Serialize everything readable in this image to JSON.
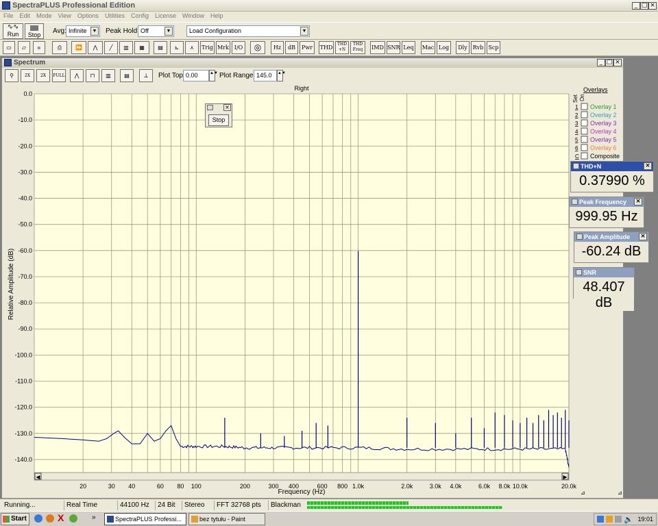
{
  "app": {
    "title": "SpectraPLUS Professional Edition",
    "menu": [
      "File",
      "Edit",
      "Mode",
      "View",
      "Options",
      "Utilities",
      "Config",
      "License",
      "Window",
      "Help"
    ]
  },
  "toolbar1": {
    "run_label": "Run",
    "stop_label": "Stop",
    "avg_label": "Avg:",
    "avg_value": "Infinite",
    "peak_hold_label": "Peak Hold:",
    "peak_hold_value": "Off",
    "load_config": "Load Configuration"
  },
  "toolbar2": {
    "text_buttons": [
      "Trig",
      "Mrk",
      "I/O",
      "Hz",
      "dB",
      "Pwr",
      "THD",
      "IMD",
      "SNR",
      "Leq",
      "Mac",
      "Log",
      "Dly",
      "Rvb",
      "Scp"
    ],
    "thd_n": "THD +N",
    "thd_freq": "THD Freq"
  },
  "spectrum_window": {
    "title": "Spectrum",
    "plot_top_label": "Plot Top:",
    "plot_top_value": "0.00",
    "plot_range_label": "Plot Range:",
    "plot_range_value": "145.0",
    "stop_button": "Stop"
  },
  "chart_data": {
    "type": "line",
    "title": "Right",
    "xlabel": "Frequency (Hz)",
    "ylabel": "Relative Amplitude (dB)",
    "x_scale": "log",
    "xlim": [
      10,
      20000
    ],
    "ylim": [
      -145,
      0
    ],
    "x_ticks": [
      "20",
      "30",
      "40",
      "60",
      "80",
      "100",
      "200",
      "300",
      "400",
      "600",
      "800",
      "1.0k",
      "2.0k",
      "3.0k",
      "4.0k",
      "6.0k",
      "8.0k",
      "10.0k",
      "20.0k"
    ],
    "y_ticks": [
      "0.0",
      "-10.0",
      "-20.0",
      "-30.0",
      "-40.0",
      "-50.0",
      "-60.0",
      "-70.0",
      "-80.0",
      "-90.0",
      "-100.0",
      "-110.0",
      "-120.0",
      "-130.0",
      "-140.0"
    ],
    "background_color": "#ffffe0",
    "grid": true,
    "series_color": "#00007f",
    "noise_floor": [
      [
        10,
        -131.5
      ],
      [
        15,
        -132
      ],
      [
        20,
        -132.5
      ],
      [
        25,
        -133
      ],
      [
        28,
        -132
      ],
      [
        31,
        -130
      ],
      [
        33,
        -129
      ],
      [
        36,
        -131.5
      ],
      [
        40,
        -134
      ],
      [
        45,
        -134
      ],
      [
        50,
        -130
      ],
      [
        55,
        -133
      ],
      [
        60,
        -132
      ],
      [
        65,
        -129
      ],
      [
        70,
        -127
      ],
      [
        75,
        -132
      ],
      [
        80,
        -135
      ],
      [
        100,
        -135
      ],
      [
        150,
        -135
      ],
      [
        200,
        -135.5
      ],
      [
        300,
        -135.5
      ],
      [
        500,
        -135.5
      ],
      [
        1000,
        -135.5
      ],
      [
        2000,
        -136
      ],
      [
        5000,
        -136
      ],
      [
        10000,
        -136
      ],
      [
        19000,
        -136
      ],
      [
        20000,
        -143
      ]
    ],
    "peaks": [
      [
        150,
        -124
      ],
      [
        250,
        -130
      ],
      [
        350,
        -131
      ],
      [
        450,
        -129
      ],
      [
        550,
        -126
      ],
      [
        650,
        -127
      ],
      [
        1000,
        -60.2
      ],
      [
        2000,
        -124
      ],
      [
        3000,
        -126
      ],
      [
        4000,
        -130
      ],
      [
        5000,
        -124
      ],
      [
        6000,
        -128
      ],
      [
        7000,
        -122
      ],
      [
        8000,
        -123
      ],
      [
        9000,
        -125
      ],
      [
        10000,
        -126
      ],
      [
        11000,
        -124
      ],
      [
        12000,
        -126
      ],
      [
        13000,
        -123
      ],
      [
        14000,
        -125
      ],
      [
        15000,
        -121
      ],
      [
        16000,
        -123
      ],
      [
        17000,
        -122
      ],
      [
        18000,
        -124
      ],
      [
        19000,
        -121
      ],
      [
        20000,
        -125
      ]
    ],
    "overlays": {
      "header": "Overlays",
      "set_label": "Set",
      "on_label": "On",
      "items": [
        {
          "num": "1",
          "label": "Overlay 1",
          "color": "#2e9a3a"
        },
        {
          "num": "2",
          "label": "Overlay 2",
          "color": "#3ca0b0"
        },
        {
          "num": "3",
          "label": "Overlay 3",
          "color": "#8a2fb0"
        },
        {
          "num": "4",
          "label": "Overlay 4",
          "color": "#c030c0"
        },
        {
          "num": "5",
          "label": "Overlay 5",
          "color": "#8a2fb0"
        },
        {
          "num": "6",
          "label": "Overlay 6",
          "color": "#f08040"
        },
        {
          "num": "C",
          "label": "Composite",
          "color": "#000000"
        }
      ]
    }
  },
  "meters": {
    "thd_n": {
      "title": "THD+N",
      "value": "0.37990 %"
    },
    "peak_freq": {
      "title": "Peak Frequency",
      "value": "999.95 Hz"
    },
    "peak_amp": {
      "title": "Peak Amplitude",
      "value": "-60.24 dB"
    },
    "snr": {
      "title": "SNR",
      "value": "48.407 dB"
    }
  },
  "status": {
    "state": "Running...",
    "mode": "Real Time",
    "rate": "44100 Hz",
    "bits": "24 Bit",
    "channels": "Stereo",
    "fft": "FFT 32768 pts",
    "window": "Blackman"
  },
  "taskbar": {
    "start": "Start",
    "tasks": [
      "SpectraPLUS Professi...",
      "bez tytułu - Paint"
    ],
    "clock": "19:01"
  }
}
